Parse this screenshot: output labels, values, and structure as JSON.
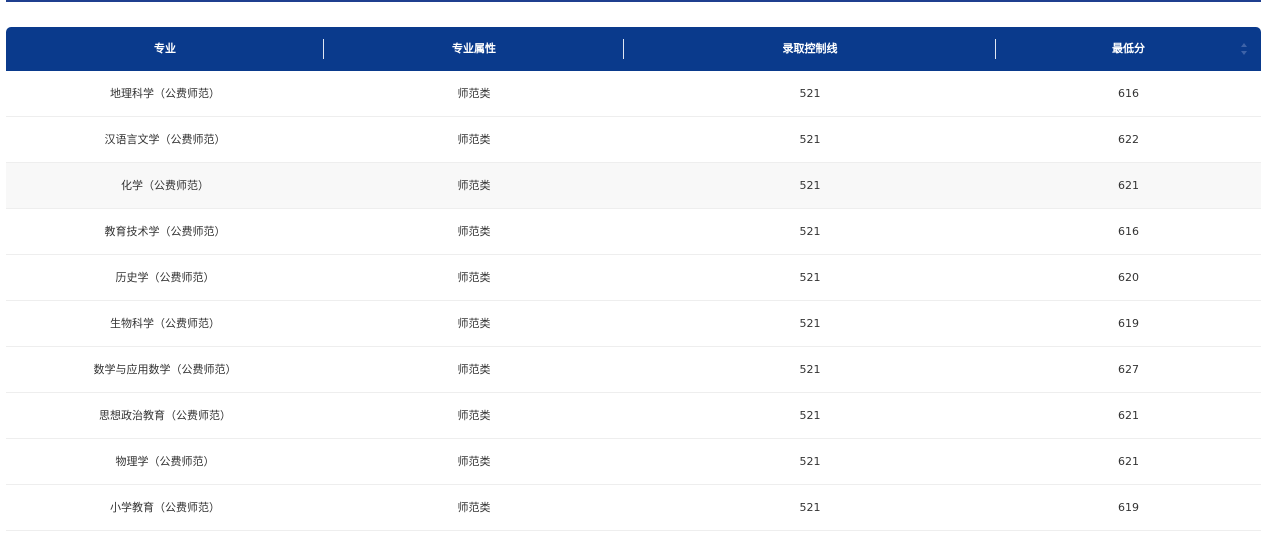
{
  "table": {
    "headers": [
      "专业",
      "专业属性",
      "录取控制线",
      "最低分"
    ],
    "rows": [
      {
        "major": "地理科学（公费师范）",
        "attribute": "师范类",
        "control_line": "521",
        "min_score": "616"
      },
      {
        "major": "汉语言文学（公费师范）",
        "attribute": "师范类",
        "control_line": "521",
        "min_score": "622"
      },
      {
        "major": "化学（公费师范）",
        "attribute": "师范类",
        "control_line": "521",
        "min_score": "621"
      },
      {
        "major": "教育技术学（公费师范）",
        "attribute": "师范类",
        "control_line": "521",
        "min_score": "616"
      },
      {
        "major": "历史学（公费师范）",
        "attribute": "师范类",
        "control_line": "521",
        "min_score": "620"
      },
      {
        "major": "生物科学（公费师范）",
        "attribute": "师范类",
        "control_line": "521",
        "min_score": "619"
      },
      {
        "major": "数学与应用数学（公费师范）",
        "attribute": "师范类",
        "control_line": "521",
        "min_score": "627"
      },
      {
        "major": "思想政治教育（公费师范）",
        "attribute": "师范类",
        "control_line": "521",
        "min_score": "621"
      },
      {
        "major": "物理学（公费师范）",
        "attribute": "师范类",
        "control_line": "521",
        "min_score": "621"
      },
      {
        "major": "小学教育（公费师范）",
        "attribute": "师范类",
        "control_line": "521",
        "min_score": "619"
      }
    ]
  },
  "colors": {
    "header_bg": "#0a3a8c",
    "top_rule": "#1f3f8f",
    "row_hover_bg": "#f8f8f8"
  },
  "icons": {
    "sort": "sort-icon"
  }
}
